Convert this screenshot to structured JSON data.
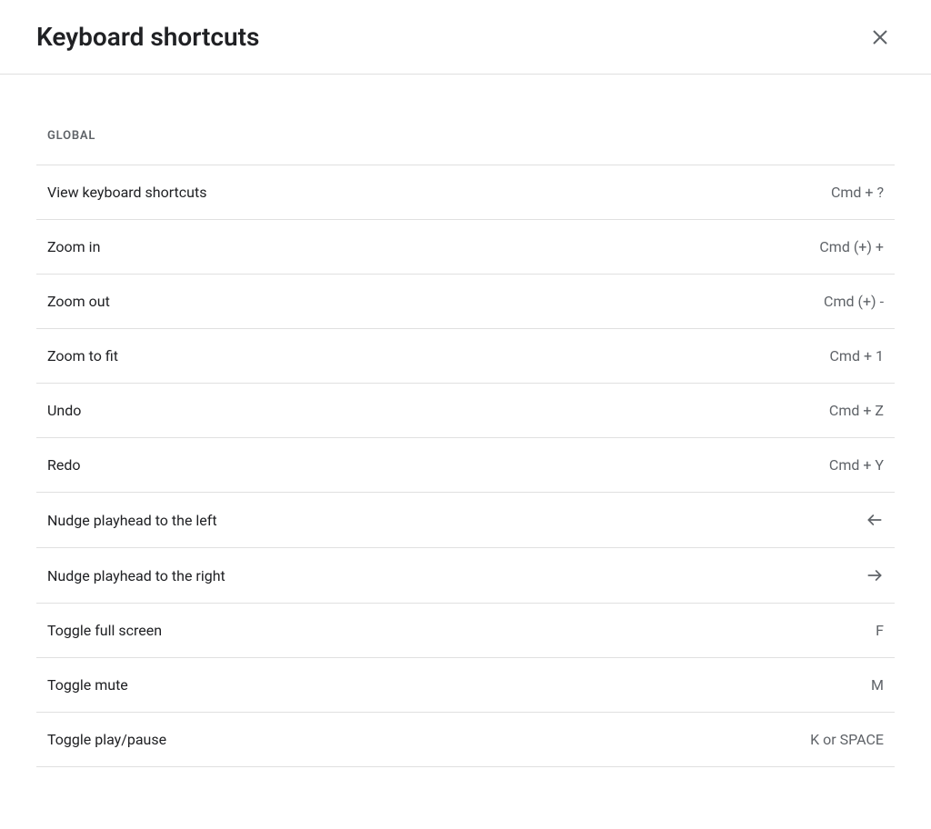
{
  "header": {
    "title": "Keyboard shortcuts"
  },
  "section": {
    "title": "GLOBAL"
  },
  "shortcuts": [
    {
      "label": "View keyboard shortcuts",
      "key": "Cmd + ?",
      "icon": null
    },
    {
      "label": "Zoom in",
      "key": "Cmd (+) +",
      "icon": null
    },
    {
      "label": "Zoom out",
      "key": "Cmd (+) -",
      "icon": null
    },
    {
      "label": "Zoom to fit",
      "key": "Cmd + 1",
      "icon": null
    },
    {
      "label": "Undo",
      "key": "Cmd + Z",
      "icon": null
    },
    {
      "label": "Redo",
      "key": "Cmd + Y",
      "icon": null
    },
    {
      "label": "Nudge playhead to the left",
      "key": "",
      "icon": "arrow-left"
    },
    {
      "label": "Nudge playhead to the right",
      "key": "",
      "icon": "arrow-right"
    },
    {
      "label": "Toggle full screen",
      "key": "F",
      "icon": null
    },
    {
      "label": "Toggle mute",
      "key": "M",
      "icon": null
    },
    {
      "label": "Toggle play/pause",
      "key": "K or SPACE",
      "icon": null
    }
  ]
}
